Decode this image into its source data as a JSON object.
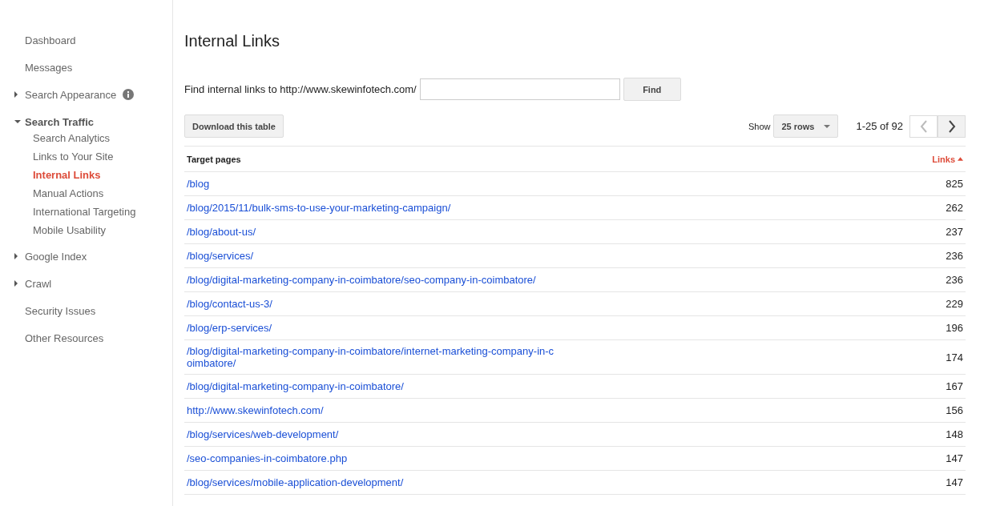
{
  "sidebar": {
    "items": [
      {
        "label": "Dashboard",
        "kind": "plain",
        "selected": false
      },
      {
        "label": "Messages",
        "kind": "plain",
        "selected": false
      },
      {
        "label": "Search Appearance",
        "kind": "collapsed",
        "info": true,
        "selected": false
      },
      {
        "label": "Search Traffic",
        "kind": "expanded",
        "selected": false,
        "children": [
          {
            "label": "Search Analytics",
            "selected": false
          },
          {
            "label": "Links to Your Site",
            "selected": false
          },
          {
            "label": "Internal Links",
            "selected": true
          },
          {
            "label": "Manual Actions",
            "selected": false
          },
          {
            "label": "International Targeting",
            "selected": false
          },
          {
            "label": "Mobile Usability",
            "selected": false
          }
        ]
      },
      {
        "label": "Google Index",
        "kind": "collapsed",
        "selected": false
      },
      {
        "label": "Crawl",
        "kind": "collapsed",
        "selected": false
      },
      {
        "label": "Security Issues",
        "kind": "plain",
        "selected": false
      },
      {
        "label": "Other Resources",
        "kind": "plain",
        "selected": false
      }
    ]
  },
  "page_title": "Internal Links",
  "find": {
    "label": "Find internal links to http://www.skewinfotech.com/",
    "button": "Find"
  },
  "download_button": "Download this table",
  "show": {
    "label": "Show",
    "value": "25 rows"
  },
  "pager": {
    "range": "1-25 of 92",
    "prev_enabled": false,
    "next_enabled": true
  },
  "table": {
    "columns": [
      {
        "label": "Target pages",
        "sorted": false
      },
      {
        "label": "Links",
        "sorted": true
      }
    ],
    "rows": [
      {
        "page": "/blog",
        "links": "825"
      },
      {
        "page": "/blog/2015/11/bulk-sms-to-use-your-marketing-campaign/",
        "links": "262"
      },
      {
        "page": "/blog/about-us/",
        "links": "237"
      },
      {
        "page": "/blog/services/",
        "links": "236"
      },
      {
        "page": "/blog/digital-marketing-company-in-coimbatore/seo-company-in-coimbatore/",
        "links": "236"
      },
      {
        "page": "/blog/contact-us-3/",
        "links": "229"
      },
      {
        "page": "/blog/erp-services/",
        "links": "196"
      },
      {
        "page": "/blog/digital-marketing-company-in-coimbatore/internet-marketing-company-in-coimbatore/",
        "links": "174"
      },
      {
        "page": "/blog/digital-marketing-company-in-coimbatore/",
        "links": "167"
      },
      {
        "page": "http://www.skewinfotech.com/",
        "links": "156"
      },
      {
        "page": "/blog/services/web-development/",
        "links": "148"
      },
      {
        "page": "/seo-companies-in-coimbatore.php",
        "links": "147"
      },
      {
        "page": "/blog/services/mobile-application-development/",
        "links": "147"
      }
    ]
  }
}
